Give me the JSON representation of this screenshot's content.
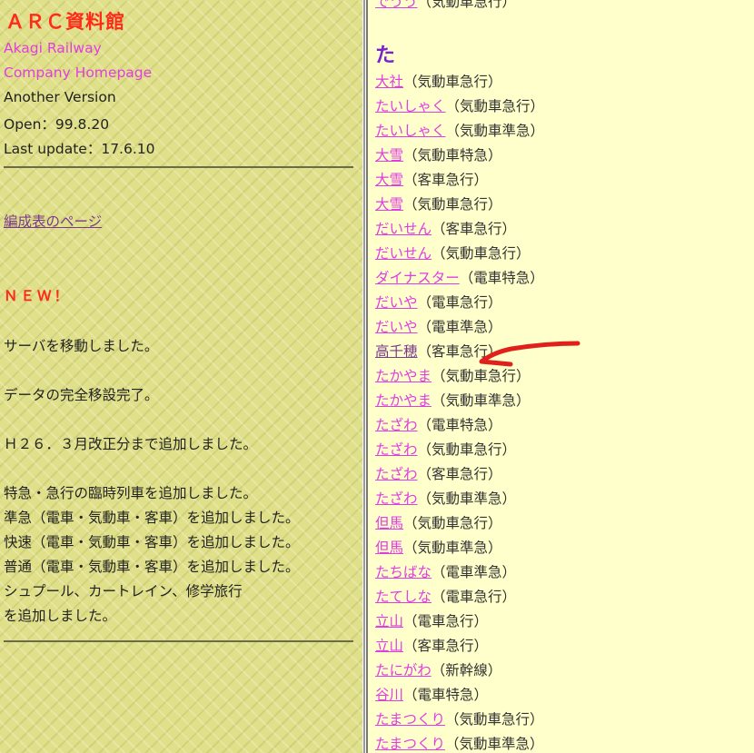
{
  "left": {
    "title": "ＡＲＣ資料館",
    "subtitle_line1": "Akagi Railway",
    "subtitle_line2": "Company Homepage",
    "version": "Another Version",
    "open": "Open：99.8.20",
    "last_update": "Last update：17.6.10",
    "formation_link": "編成表のページ",
    "new_heading": "ＮＥＷ！",
    "news": [
      "サーバを移動しました。",
      "データの完全移設完了。",
      "Ｈ２６．３月改正分まで追加しました。",
      "特急・急行の臨時列車を追加しました。",
      "準急（電車・気動車・客車）を追加しました。",
      "快速（電車・気動車・客車）を追加しました。",
      "普通（電車・気動車・客車）を追加しました。",
      "シュプール、カートレイン、修学旅行",
      "を追加しました。"
    ]
  },
  "right": {
    "top_partial_name": "でうう",
    "top_partial_type": "（気動車急行）",
    "heading": "た",
    "trains": [
      {
        "name": "大社",
        "type": "（気動車急行）"
      },
      {
        "name": "たいしゃく",
        "type": "（気動車急行）"
      },
      {
        "name": "たいしゃく",
        "type": "（気動車準急）"
      },
      {
        "name": "大雪",
        "type": "（気動車特急）"
      },
      {
        "name": "大雪",
        "type": "（客車急行）"
      },
      {
        "name": "大雪",
        "type": "（気動車急行）"
      },
      {
        "name": "だいせん",
        "type": "（客車急行）"
      },
      {
        "name": "だいせん",
        "type": "（気動車急行）"
      },
      {
        "name": "ダイナスター",
        "type": "（電車特急）"
      },
      {
        "name": "だいや",
        "type": "（電車急行）"
      },
      {
        "name": "だいや",
        "type": "（電車準急）"
      },
      {
        "name": "高千穂",
        "type": "（客車急行）"
      },
      {
        "name": "たかやま",
        "type": "（気動車急行）"
      },
      {
        "name": "たかやま",
        "type": "（気動車準急）"
      },
      {
        "name": "たざわ",
        "type": "（電車特急）"
      },
      {
        "name": "たざわ",
        "type": "（気動車急行）"
      },
      {
        "name": "たざわ",
        "type": "（客車急行）"
      },
      {
        "name": "たざわ",
        "type": "（気動車準急）"
      },
      {
        "name": "但馬",
        "type": "（気動車急行）"
      },
      {
        "name": "但馬",
        "type": "（気動車準急）"
      },
      {
        "name": "たちばな",
        "type": "（電車準急）"
      },
      {
        "name": "たてしな",
        "type": "（電車急行）"
      },
      {
        "name": "立山",
        "type": "（電車急行）"
      },
      {
        "name": "立山",
        "type": "（客車急行）"
      },
      {
        "name": "たにがわ",
        "type": "（新幹線）"
      },
      {
        "name": "谷川",
        "type": "（電車特急）"
      },
      {
        "name": "たまつくり",
        "type": "（気動車急行）"
      },
      {
        "name": "たまつくり",
        "type": "（気動車準急）"
      }
    ]
  },
  "colors": {
    "left_bg": "#e0e08a",
    "right_bg": "#ffffcc",
    "title": "#ff2a1a",
    "link": "#e03ee0",
    "visited_link": "#7a3a8c",
    "heading": "#7a22cc",
    "annotation_arrow": "#e0201a"
  }
}
